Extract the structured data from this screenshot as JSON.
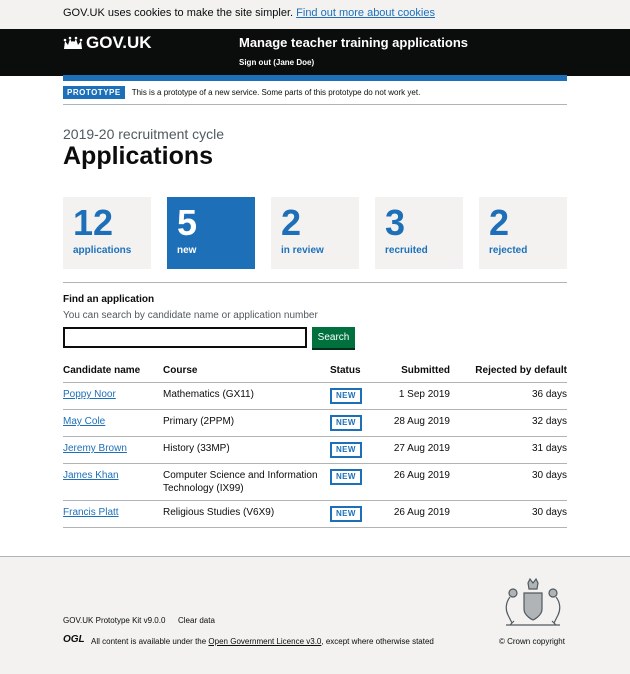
{
  "cookie_banner": {
    "text": "GOV.UK uses cookies to make the site simpler.",
    "link": "Find out more about cookies"
  },
  "header": {
    "logo_text": "GOV.UK",
    "service_name": "Manage teacher training applications",
    "sign_out": "Sign out (Jane Doe)"
  },
  "prototype_banner": {
    "tag": "PROTOTYPE",
    "text": "This is a prototype of a new service. Some parts of this prototype do not work yet."
  },
  "page": {
    "caption": "2019-20 recruitment cycle",
    "title": "Applications"
  },
  "stats": [
    {
      "number": "12",
      "label": "applications"
    },
    {
      "number": "5",
      "label": "new"
    },
    {
      "number": "2",
      "label": "in review"
    },
    {
      "number": "3",
      "label": "recruited"
    },
    {
      "number": "2",
      "label": "rejected"
    }
  ],
  "search": {
    "label": "Find an application",
    "hint": "You can search by candidate name or application number",
    "value": "",
    "button": "Search"
  },
  "table": {
    "headers": [
      "Candidate name",
      "Course",
      "Status",
      "Submitted",
      "Rejected by default"
    ],
    "rows": [
      {
        "name": "Poppy Noor",
        "course": "Mathematics (GX11)",
        "status": "NEW",
        "submitted": "1 Sep 2019",
        "rbd": "36 days"
      },
      {
        "name": "May Cole",
        "course": "Primary (2PPM)",
        "status": "NEW",
        "submitted": "28 Aug 2019",
        "rbd": "32 days"
      },
      {
        "name": "Jeremy Brown",
        "course": "History (33MP)",
        "status": "NEW",
        "submitted": "27 Aug 2019",
        "rbd": "31 days"
      },
      {
        "name": "James Khan",
        "course": "Computer Science and Information Technology (IX99)",
        "status": "NEW",
        "submitted": "26 Aug 2019",
        "rbd": "30 days"
      },
      {
        "name": "Francis Platt",
        "course": "Religious Studies (V6X9)",
        "status": "NEW",
        "submitted": "26 Aug 2019",
        "rbd": "30 days"
      }
    ]
  },
  "footer": {
    "kit": "GOV.UK Prototype Kit v9.0.0",
    "clear": "Clear data",
    "ogl": "OGL",
    "licence_prefix": "All content is available under the",
    "licence_link": "Open Government Licence v3.0",
    "licence_suffix": ", except where otherwise stated",
    "copyright": "© Crown copyright"
  },
  "colors": {
    "brand_blue": "#1d70b8",
    "header_black": "#0b0c0c",
    "button_green": "#00703c",
    "panel_grey": "#f3f2f1"
  }
}
